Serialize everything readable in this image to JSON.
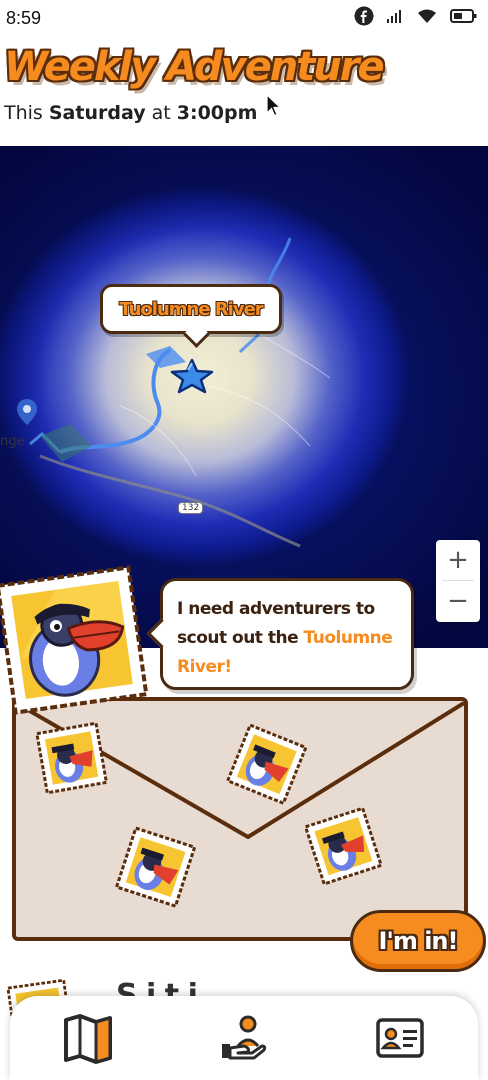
{
  "status_bar": {
    "time": "8:59",
    "icons": [
      "facebook-icon",
      "signal-icon",
      "wifi-icon",
      "battery-icon"
    ]
  },
  "header": {
    "title": "Weekly Adventure",
    "subtitle_prefix": "This ",
    "subtitle_day": "Saturday",
    "subtitle_mid": " at ",
    "subtitle_time": "3:00pm"
  },
  "map": {
    "location_label": "Tuolumne River",
    "road_label": "132",
    "place_text": "nge",
    "zoom_in": "+",
    "zoom_out": "−"
  },
  "message": {
    "text_before": "I need adventurers to scout out the ",
    "text_highlight": "Tuolumne River!"
  },
  "cta": {
    "label": "I'm in!"
  },
  "peek": {
    "text": "S   i t   i"
  },
  "bottom_nav": {
    "items": [
      "map-icon",
      "volunteer-hand-icon",
      "id-card-icon"
    ]
  },
  "colors": {
    "accent_orange": "#f68b1f",
    "outline_brown": "#4a2a10",
    "envelope_fill": "#e8dcd2",
    "stamp_yellow": "#f7c531",
    "map_blue": "#1f2db6"
  }
}
